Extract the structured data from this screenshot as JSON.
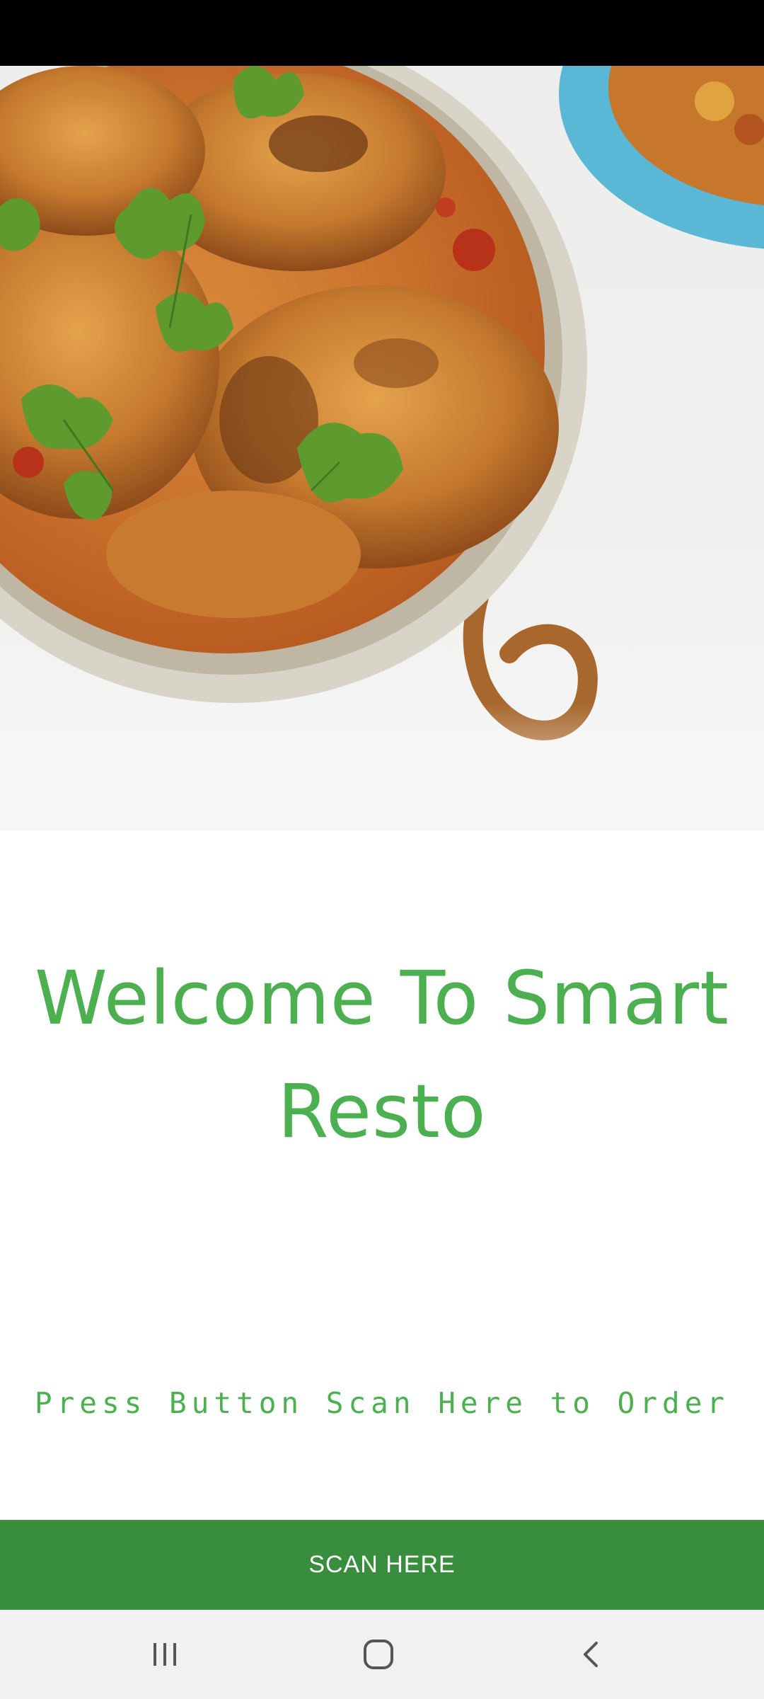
{
  "hero": {
    "image_icon": "curry-dish-photo"
  },
  "welcome": {
    "line1": "Welcome To Smart",
    "line2": "Resto"
  },
  "instruction": {
    "text": "Press Button Scan Here to Order"
  },
  "scan_button": {
    "label": "SCAN HERE"
  },
  "nav_bar": {
    "recents_icon": "recents-icon",
    "home_icon": "home-icon",
    "back_icon": "back-icon"
  },
  "colors": {
    "accent_text": "#4caf50",
    "button_bg": "#388e3c",
    "status_bar": "#000000",
    "nav_bar": "#f1f1f1"
  }
}
